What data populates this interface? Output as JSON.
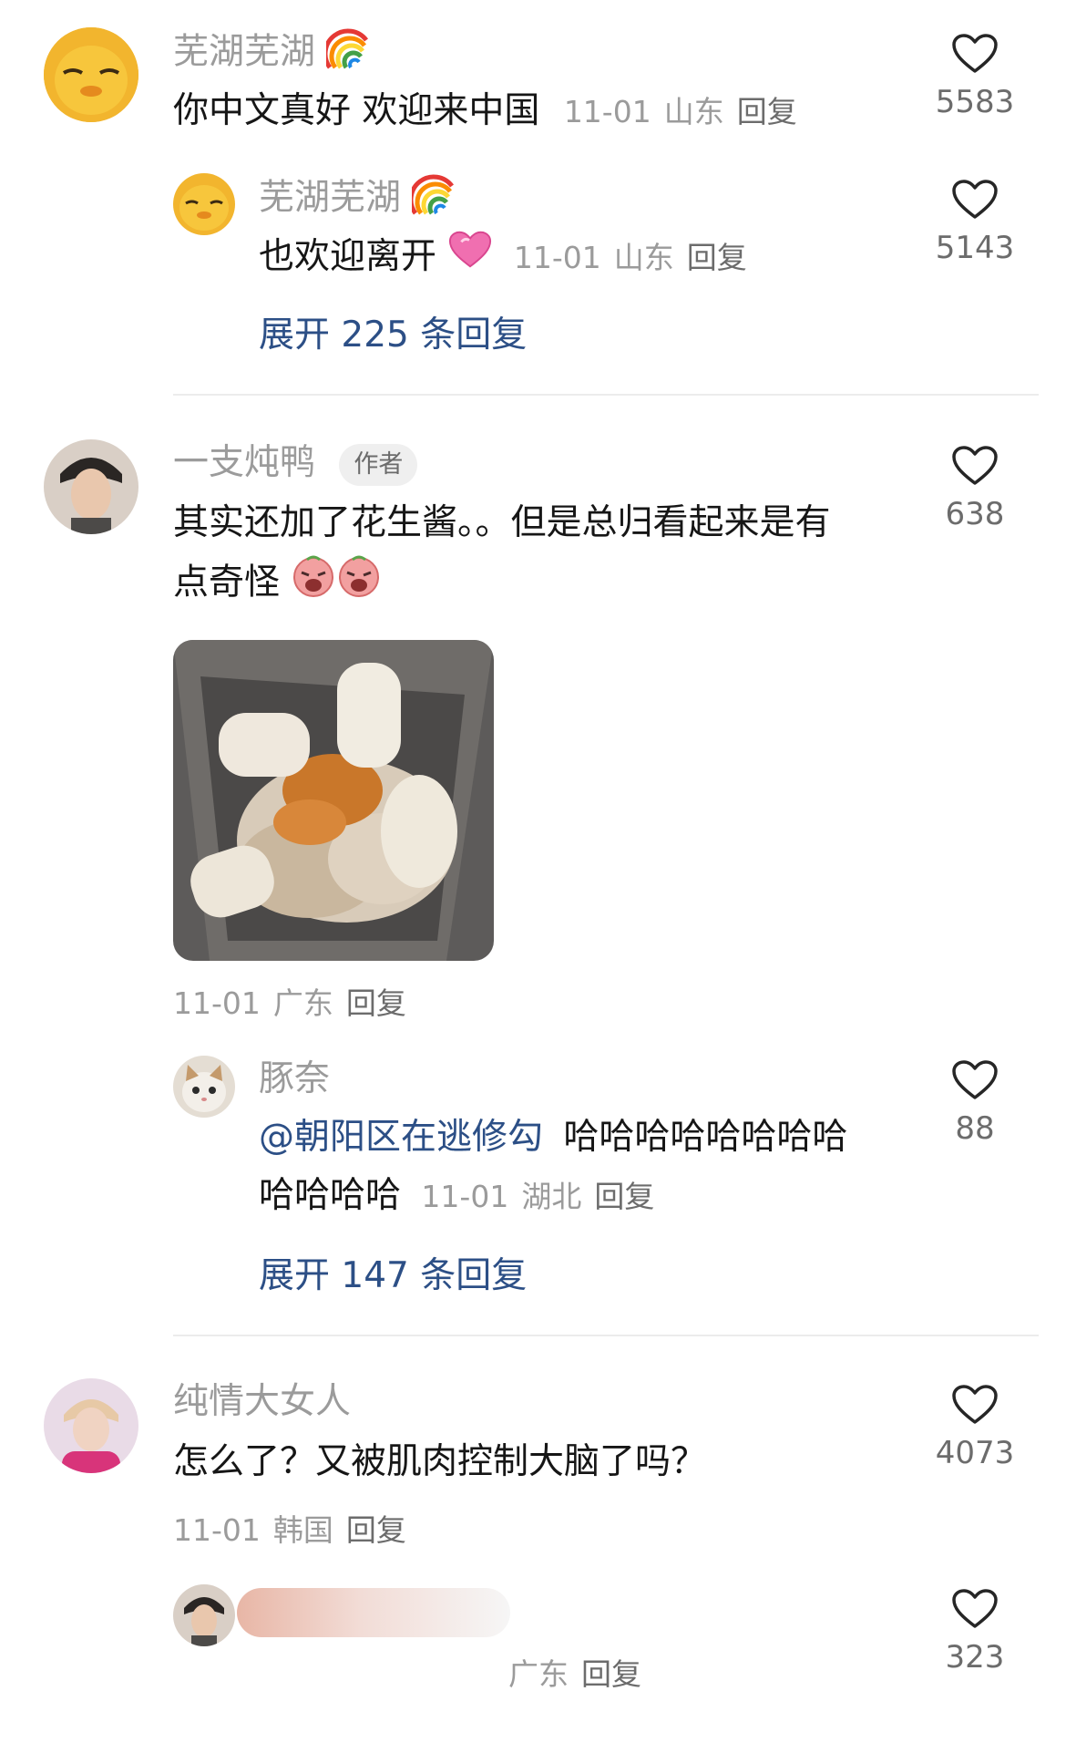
{
  "comments": [
    {
      "username": "芜湖芜湖",
      "text": "你中文真好 欢迎来中国",
      "date": "11-01",
      "location": "山东",
      "reply_label": "回复",
      "likes": "5583",
      "reply": {
        "username": "芜湖芜湖",
        "text": "也欢迎离开",
        "date": "11-01",
        "location": "山东",
        "reply_label": "回复",
        "likes": "5143"
      },
      "expand_label": "展开 225 条回复"
    },
    {
      "username": "一支炖鸭",
      "badge": "作者",
      "text_line1": "其实还加了花生酱。。但是总归看起来是有",
      "text_line2": "点奇怪",
      "date": "11-01",
      "location": "广东",
      "reply_label": "回复",
      "likes": "638",
      "reply": {
        "username": "豚奈",
        "mention": "@朝阳区在逃修勾",
        "text_line1": "哈哈哈哈哈哈哈哈",
        "text_line2": "哈哈哈哈",
        "date": "11-01",
        "location": "湖北",
        "reply_label": "回复",
        "likes": "88"
      },
      "expand_label": "展开 147 条回复"
    },
    {
      "username": "纯情大女人",
      "text": "怎么了？又被肌肉控制大脑了吗？",
      "date": "11-01",
      "location": "韩国",
      "reply_label": "回复",
      "likes": "4073",
      "reply": {
        "location": "广东",
        "reply_label": "回复",
        "likes": "323"
      }
    }
  ],
  "icons": {
    "like": "heart-outline-icon",
    "rainbow": "rainbow-emoji-icon",
    "heart_emoji": "pink-heart-emoji-icon",
    "crying_emoji": "crying-emoji-icon"
  }
}
